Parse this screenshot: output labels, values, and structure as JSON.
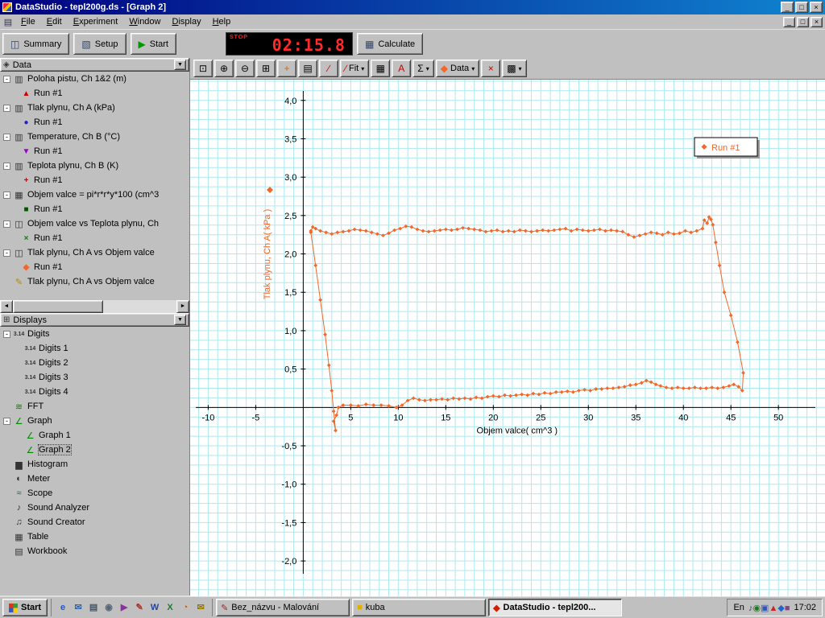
{
  "window": {
    "title": "DataStudio - tepl200g.ds - [Graph 2]"
  },
  "icons": {
    "minimize": "_",
    "maximize": "□",
    "close": "×",
    "document": "▤",
    "dropdown": "▼",
    "small_dropdown": "▾",
    "collapse": "-",
    "scroll_left": "◄",
    "scroll_right": "►"
  },
  "menu": {
    "items": [
      "File",
      "Edit",
      "Experiment",
      "Window",
      "Display",
      "Help"
    ]
  },
  "toolbar": {
    "summary": {
      "label": "Summary",
      "glyph": "◫"
    },
    "setup": {
      "label": "Setup",
      "glyph": "▧"
    },
    "start": {
      "label": "Start",
      "glyph": "▶",
      "glyph_color": "#009900"
    },
    "calculate": {
      "label": "Calculate",
      "glyph": "▦"
    },
    "timer": {
      "stop_label": "STOP",
      "value": "02:15.8"
    }
  },
  "graph_toolbar": {
    "items": [
      {
        "type": "button",
        "name": "scale-to-fit-button",
        "glyph": "⊡"
      },
      {
        "type": "button",
        "name": "zoom-in-button",
        "glyph": "⊕"
      },
      {
        "type": "button",
        "name": "zoom-out-button",
        "glyph": "⊖"
      },
      {
        "type": "button",
        "name": "zoom-select-button",
        "glyph": "⊞"
      },
      {
        "type": "button",
        "name": "smart-tool-button",
        "glyph": "+",
        "color": "#dd6600"
      },
      {
        "type": "button",
        "name": "note-tool-button",
        "glyph": "▤"
      },
      {
        "type": "button",
        "name": "slope-tool-button",
        "glyph": "∕",
        "color": "#cc0000"
      },
      {
        "type": "dropdown",
        "name": "fit-dropdown",
        "label": "Fit",
        "glyph": "∕",
        "color": "#cc0000"
      },
      {
        "type": "button",
        "name": "calculator-button",
        "glyph": "▦"
      },
      {
        "type": "button",
        "name": "text-tool-button",
        "glyph": "A",
        "color": "#cc0000"
      },
      {
        "type": "dropdown",
        "name": "statistics-dropdown",
        "glyph": "Σ"
      },
      {
        "type": "dropdown",
        "name": "data-dropdown",
        "label": "Data",
        "glyph": "◆",
        "color": "#f3682a"
      },
      {
        "type": "button",
        "name": "delete-button",
        "glyph": "×",
        "color": "#cc0000"
      },
      {
        "type": "dropdown",
        "name": "graph-settings-dropdown",
        "glyph": "▩"
      }
    ]
  },
  "sidebar": {
    "data_panel": {
      "label": "Data",
      "icon_glyph": "◈"
    },
    "displays_panel": {
      "label": "Displays",
      "icon_glyph": "⊞"
    },
    "selected_item": "Graph 2",
    "data_tree": [
      {
        "label": "Poloha pistu, Ch 1&2 (m)",
        "icon": "sensor-icon",
        "glyph": "▥",
        "runs": [
          {
            "label": "Run #1",
            "marker": "▲",
            "color": "#cc0000"
          }
        ]
      },
      {
        "label": "Tlak plynu, Ch A (kPa)",
        "icon": "sensor-icon",
        "glyph": "▥",
        "runs": [
          {
            "label": "Run #1",
            "marker": "●",
            "color": "#2222cc"
          }
        ]
      },
      {
        "label": "Temperature, Ch B (°C)",
        "icon": "sensor-icon",
        "glyph": "▥",
        "runs": [
          {
            "label": "Run #1",
            "marker": "▼",
            "color": "#9900cc"
          }
        ]
      },
      {
        "label": "Teplota plynu, Ch B (K)",
        "icon": "sensor-icon",
        "glyph": "▥",
        "runs": [
          {
            "label": "Run #1",
            "marker": "+",
            "color": "#cc0000"
          }
        ]
      },
      {
        "label": "Objem valce = pi*r*r*y*100 (cm^3",
        "icon": "calculator-icon",
        "glyph": "▦",
        "runs": [
          {
            "label": "Run #1",
            "marker": "■",
            "color": "#005500"
          }
        ]
      },
      {
        "label": "Objem valce vs Teplota plynu, Ch",
        "icon": "xy-data-icon",
        "glyph": "◫",
        "runs": [
          {
            "label": "Run #1",
            "marker": "×",
            "color": "#008800"
          }
        ]
      },
      {
        "label": "Tlak plynu, Ch A vs Objem valce",
        "icon": "xy-data-icon",
        "glyph": "◫",
        "runs": [
          {
            "label": "Run #1",
            "marker": "◆",
            "color": "#f3682a"
          }
        ]
      },
      {
        "label": "Tlak plynu, Ch A vs Objem valce",
        "icon": "pen-icon",
        "glyph": "✎",
        "icon_color": "#b58900",
        "runs": []
      }
    ],
    "displays_tree": [
      {
        "label": "Digits",
        "icon": "digits-icon",
        "glyph": "3.14",
        "children": [
          "Digits 1",
          "Digits 2",
          "Digits 3",
          "Digits 4"
        ]
      },
      {
        "label": "FFT",
        "icon": "fft-icon",
        "glyph": "≋",
        "color": "#008800"
      },
      {
        "label": "Graph",
        "icon": "graph-icon",
        "glyph": "∠",
        "color": "#008800",
        "children": [
          "Graph 1",
          "Graph 2"
        ]
      },
      {
        "label": "Histogram",
        "icon": "histogram-icon",
        "glyph": "▆",
        "color": "#333333"
      },
      {
        "label": "Meter",
        "icon": "meter-icon",
        "glyph": "◐",
        "color": "#333333"
      },
      {
        "label": "Scope",
        "icon": "scope-icon",
        "glyph": "≈",
        "color": "#006666"
      },
      {
        "label": "Sound Analyzer",
        "icon": "sound-analyzer-icon",
        "glyph": "♪",
        "color": "#333333"
      },
      {
        "label": "Sound Creator",
        "icon": "sound-creator-icon",
        "glyph": "♫",
        "color": "#333333"
      },
      {
        "label": "Table",
        "icon": "table-icon",
        "glyph": "▦",
        "color": "#333333"
      },
      {
        "label": "Workbook",
        "icon": "workbook-icon",
        "glyph": "▤",
        "color": "#333333"
      }
    ]
  },
  "chart_data": {
    "type": "line",
    "xlabel": "Objem valce( cm^3 )",
    "ylabel": "Tlak plynu, Ch A( kPa )",
    "xlim": [
      -11.9,
      54.9
    ],
    "ylim": [
      -2.46,
      4.27
    ],
    "grid": true,
    "grid_color": "#aceaef",
    "x_ticks": [
      -10,
      -5,
      5,
      10,
      15,
      20,
      25,
      30,
      35,
      40,
      45,
      50
    ],
    "y_ticks": [
      {
        "v": 4.0,
        "label": "4,0"
      },
      {
        "v": 3.5,
        "label": "3,5"
      },
      {
        "v": 3.0,
        "label": "3,0"
      },
      {
        "v": 2.5,
        "label": "2,5"
      },
      {
        "v": 2.0,
        "label": "2,0"
      },
      {
        "v": 1.5,
        "label": "1,5"
      },
      {
        "v": 1.0,
        "label": "1,0"
      },
      {
        "v": 0.5,
        "label": "0,5"
      },
      {
        "v": -0.5,
        "label": "-0,5"
      },
      {
        "v": -1.0,
        "label": "-1,0"
      },
      {
        "v": -1.5,
        "label": "-1,5"
      },
      {
        "v": -2.0,
        "label": "-2,0"
      }
    ],
    "legend": {
      "label": "Run #1",
      "position": "top-right"
    },
    "series": [
      {
        "name": "Run #1",
        "color": "#f3682a",
        "marker": "diamond",
        "points": [
          [
            0.8,
            2.28
          ],
          [
            1.3,
            1.85
          ],
          [
            1.8,
            1.4
          ],
          [
            2.3,
            0.95
          ],
          [
            2.7,
            0.55
          ],
          [
            3.0,
            0.22
          ],
          [
            3.2,
            -0.05
          ],
          [
            3.4,
            -0.3
          ],
          [
            3.2,
            -0.18
          ],
          [
            3.5,
            -0.1
          ],
          [
            3.7,
            0.0
          ],
          [
            4.2,
            0.03
          ],
          [
            5.0,
            0.03
          ],
          [
            5.8,
            0.02
          ],
          [
            6.6,
            0.04
          ],
          [
            7.4,
            0.03
          ],
          [
            8.2,
            0.03
          ],
          [
            9.0,
            0.02
          ],
          [
            9.8,
            0.0
          ],
          [
            10.4,
            0.03
          ],
          [
            11.0,
            0.09
          ],
          [
            11.6,
            0.12
          ],
          [
            12.2,
            0.1
          ],
          [
            12.8,
            0.09
          ],
          [
            13.4,
            0.1
          ],
          [
            14.0,
            0.1
          ],
          [
            14.6,
            0.11
          ],
          [
            15.2,
            0.1
          ],
          [
            15.8,
            0.12
          ],
          [
            16.4,
            0.11
          ],
          [
            17.0,
            0.12
          ],
          [
            17.6,
            0.11
          ],
          [
            18.2,
            0.13
          ],
          [
            18.8,
            0.12
          ],
          [
            19.4,
            0.14
          ],
          [
            20.0,
            0.15
          ],
          [
            20.6,
            0.14
          ],
          [
            21.2,
            0.16
          ],
          [
            21.8,
            0.15
          ],
          [
            22.4,
            0.16
          ],
          [
            23.0,
            0.17
          ],
          [
            23.6,
            0.16
          ],
          [
            24.2,
            0.18
          ],
          [
            24.8,
            0.17
          ],
          [
            25.4,
            0.19
          ],
          [
            26.0,
            0.18
          ],
          [
            26.6,
            0.2
          ],
          [
            27.2,
            0.2
          ],
          [
            27.8,
            0.21
          ],
          [
            28.4,
            0.2
          ],
          [
            29.0,
            0.22
          ],
          [
            29.6,
            0.23
          ],
          [
            30.2,
            0.22
          ],
          [
            30.8,
            0.24
          ],
          [
            31.4,
            0.24
          ],
          [
            32.0,
            0.25
          ],
          [
            32.6,
            0.25
          ],
          [
            33.2,
            0.26
          ],
          [
            33.8,
            0.27
          ],
          [
            34.4,
            0.29
          ],
          [
            35.0,
            0.3
          ],
          [
            35.6,
            0.32
          ],
          [
            36.1,
            0.35
          ],
          [
            36.6,
            0.33
          ],
          [
            37.1,
            0.3
          ],
          [
            37.6,
            0.28
          ],
          [
            38.2,
            0.26
          ],
          [
            38.8,
            0.25
          ],
          [
            39.4,
            0.26
          ],
          [
            40.0,
            0.25
          ],
          [
            40.6,
            0.25
          ],
          [
            41.2,
            0.26
          ],
          [
            41.8,
            0.25
          ],
          [
            42.4,
            0.25
          ],
          [
            43.0,
            0.26
          ],
          [
            43.6,
            0.25
          ],
          [
            44.2,
            0.26
          ],
          [
            44.8,
            0.28
          ],
          [
            45.3,
            0.3
          ],
          [
            45.8,
            0.27
          ],
          [
            46.2,
            0.22
          ],
          [
            46.3,
            0.45
          ],
          [
            45.7,
            0.85
          ],
          [
            45.0,
            1.2
          ],
          [
            44.3,
            1.5
          ],
          [
            43.8,
            1.85
          ],
          [
            43.4,
            2.15
          ],
          [
            43.1,
            2.38
          ],
          [
            42.9,
            2.45
          ],
          [
            42.7,
            2.48
          ],
          [
            42.5,
            2.4
          ],
          [
            42.2,
            2.44
          ],
          [
            42.0,
            2.33
          ],
          [
            41.4,
            2.3
          ],
          [
            40.8,
            2.28
          ],
          [
            40.2,
            2.3
          ],
          [
            39.6,
            2.27
          ],
          [
            39.0,
            2.26
          ],
          [
            38.4,
            2.28
          ],
          [
            37.8,
            2.25
          ],
          [
            37.2,
            2.27
          ],
          [
            36.6,
            2.28
          ],
          [
            36.0,
            2.26
          ],
          [
            35.4,
            2.24
          ],
          [
            34.8,
            2.22
          ],
          [
            34.2,
            2.25
          ],
          [
            33.6,
            2.29
          ],
          [
            33.0,
            2.3
          ],
          [
            32.4,
            2.31
          ],
          [
            31.8,
            2.3
          ],
          [
            31.2,
            2.32
          ],
          [
            30.6,
            2.31
          ],
          [
            30.0,
            2.3
          ],
          [
            29.4,
            2.31
          ],
          [
            28.8,
            2.32
          ],
          [
            28.2,
            2.3
          ],
          [
            27.6,
            2.33
          ],
          [
            27.0,
            2.32
          ],
          [
            26.4,
            2.31
          ],
          [
            25.8,
            2.3
          ],
          [
            25.2,
            2.31
          ],
          [
            24.6,
            2.3
          ],
          [
            24.0,
            2.29
          ],
          [
            23.4,
            2.3
          ],
          [
            22.8,
            2.31
          ],
          [
            22.2,
            2.29
          ],
          [
            21.6,
            2.3
          ],
          [
            21.0,
            2.29
          ],
          [
            20.4,
            2.31
          ],
          [
            19.8,
            2.3
          ],
          [
            19.2,
            2.29
          ],
          [
            18.6,
            2.31
          ],
          [
            18.0,
            2.32
          ],
          [
            17.4,
            2.33
          ],
          [
            16.8,
            2.34
          ],
          [
            16.2,
            2.32
          ],
          [
            15.6,
            2.31
          ],
          [
            15.0,
            2.32
          ],
          [
            14.4,
            2.31
          ],
          [
            13.8,
            2.3
          ],
          [
            13.2,
            2.29
          ],
          [
            12.6,
            2.3
          ],
          [
            12.0,
            2.32
          ],
          [
            11.4,
            2.35
          ],
          [
            10.8,
            2.36
          ],
          [
            10.2,
            2.33
          ],
          [
            9.6,
            2.31
          ],
          [
            9.0,
            2.27
          ],
          [
            8.4,
            2.24
          ],
          [
            7.8,
            2.26
          ],
          [
            7.2,
            2.28
          ],
          [
            6.6,
            2.3
          ],
          [
            6.0,
            2.31
          ],
          [
            5.4,
            2.32
          ],
          [
            4.8,
            2.3
          ],
          [
            4.2,
            2.29
          ],
          [
            3.6,
            2.28
          ],
          [
            3.0,
            2.26
          ],
          [
            2.4,
            2.28
          ],
          [
            1.8,
            2.3
          ],
          [
            1.3,
            2.33
          ],
          [
            1.0,
            2.35
          ],
          [
            0.8,
            2.3
          ]
        ]
      }
    ]
  },
  "taskbar": {
    "start_label": "Start",
    "quick_launch": [
      {
        "name": "ie-icon",
        "glyph": "e",
        "color": "#2255cc"
      },
      {
        "name": "outlook-icon",
        "glyph": "✉",
        "color": "#3366aa"
      },
      {
        "name": "show-desktop-icon",
        "glyph": "▤",
        "color": "#445566"
      },
      {
        "name": "channels-icon",
        "glyph": "◉",
        "color": "#556677"
      },
      {
        "name": "media-player-icon",
        "glyph": "▶",
        "color": "#883399"
      },
      {
        "name": "paint-icon",
        "glyph": "✎",
        "color": "#aa3333"
      },
      {
        "name": "word-icon",
        "glyph": "W",
        "color": "#2244aa"
      },
      {
        "name": "excel-icon",
        "glyph": "X",
        "color": "#227733"
      },
      {
        "name": "browser-icon",
        "glyph": "◔",
        "color": "#cc5500"
      },
      {
        "name": "mail-icon",
        "glyph": "✉",
        "color": "#997700"
      }
    ],
    "tasks": [
      {
        "name": "task-paint",
        "icon": "paint-icon",
        "glyph": "✎",
        "color": "#aa2222",
        "label": "Bez_názvu - Malování",
        "active": false
      },
      {
        "name": "task-folder-kuba",
        "icon": "folder-icon",
        "glyph": "■",
        "color": "#e0b000",
        "label": "kuba",
        "active": false
      },
      {
        "name": "task-datastudio",
        "icon": "datastudio-icon",
        "glyph": "◆",
        "color": "#cc2200",
        "label": "DataStudio - tepl200...",
        "active": true
      }
    ],
    "tray": {
      "language": "En",
      "clock": "17:02",
      "icons": [
        {
          "name": "volume-icon",
          "glyph": "♪",
          "color": "#444444"
        },
        {
          "name": "power-icon",
          "glyph": "◉",
          "color": "#227722"
        },
        {
          "name": "display-icon",
          "glyph": "▣",
          "color": "#3355bb"
        },
        {
          "name": "antivirus-icon",
          "glyph": "▲",
          "color": "#cc2222"
        },
        {
          "name": "messenger-icon",
          "glyph": "◆",
          "color": "#2266cc"
        },
        {
          "name": "scheduler-icon",
          "glyph": "■",
          "color": "#884488"
        }
      ]
    }
  }
}
